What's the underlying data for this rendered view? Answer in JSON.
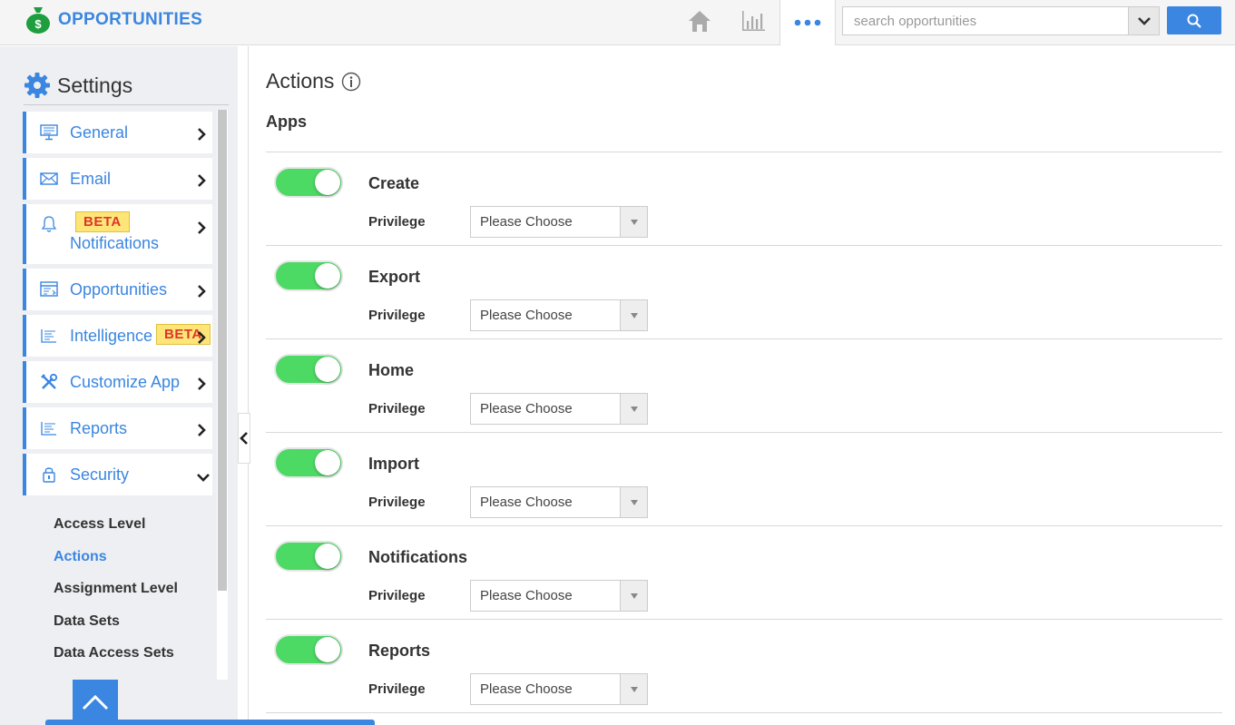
{
  "app": {
    "title": "OPPORTUNITIES"
  },
  "header": {
    "home_icon": "home-icon",
    "reports_icon": "bar-chart-icon",
    "more_icon": "more-dots-icon",
    "search": {
      "placeholder": "search opportunities",
      "value": ""
    }
  },
  "sidebar": {
    "title": "Settings",
    "items": [
      {
        "label": "General",
        "icon": "monitor-icon"
      },
      {
        "label": "Email",
        "icon": "envelope-icon"
      },
      {
        "label": "Notifications",
        "icon": "bell-icon",
        "badge": "BETA"
      },
      {
        "label": "Opportunities",
        "icon": "window-icon"
      },
      {
        "label": "Intelligence",
        "icon": "list-icon",
        "badge": "BETA"
      },
      {
        "label": "Customize App",
        "icon": "tools-icon"
      },
      {
        "label": "Reports",
        "icon": "list-icon"
      },
      {
        "label": "Security",
        "icon": "lock-icon"
      }
    ],
    "security_sub": [
      "Access Level",
      "Actions",
      "Assignment Level",
      "Data Sets",
      "Data Access Sets"
    ]
  },
  "main": {
    "title": "Actions",
    "section": "Apps",
    "privilege_label": "Privilege",
    "select_placeholder": "Please Choose",
    "actions": [
      {
        "name": "Create",
        "enabled": true
      },
      {
        "name": "Export",
        "enabled": true
      },
      {
        "name": "Home",
        "enabled": true
      },
      {
        "name": "Import",
        "enabled": true
      },
      {
        "name": "Notifications",
        "enabled": true
      },
      {
        "name": "Reports",
        "enabled": true
      }
    ]
  },
  "colors": {
    "accent": "#3a86e0",
    "toggle_on": "#4cd964",
    "beta_bg": "#fde677",
    "beta_text": "#e0342c"
  }
}
